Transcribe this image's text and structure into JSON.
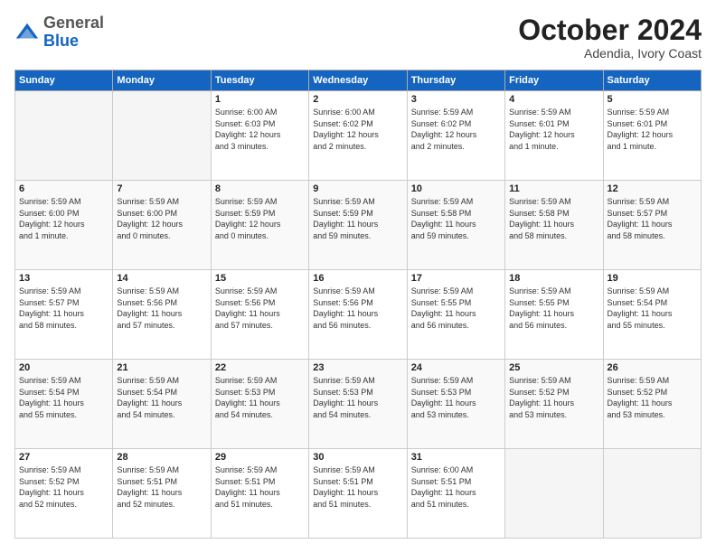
{
  "header": {
    "logo": {
      "line1": "General",
      "line2": "Blue"
    },
    "month": "October 2024",
    "location": "Adendia, Ivory Coast"
  },
  "weekdays": [
    "Sunday",
    "Monday",
    "Tuesday",
    "Wednesday",
    "Thursday",
    "Friday",
    "Saturday"
  ],
  "weeks": [
    [
      {
        "day": "",
        "info": ""
      },
      {
        "day": "",
        "info": ""
      },
      {
        "day": "1",
        "info": "Sunrise: 6:00 AM\nSunset: 6:03 PM\nDaylight: 12 hours\nand 3 minutes."
      },
      {
        "day": "2",
        "info": "Sunrise: 6:00 AM\nSunset: 6:02 PM\nDaylight: 12 hours\nand 2 minutes."
      },
      {
        "day": "3",
        "info": "Sunrise: 5:59 AM\nSunset: 6:02 PM\nDaylight: 12 hours\nand 2 minutes."
      },
      {
        "day": "4",
        "info": "Sunrise: 5:59 AM\nSunset: 6:01 PM\nDaylight: 12 hours\nand 1 minute."
      },
      {
        "day": "5",
        "info": "Sunrise: 5:59 AM\nSunset: 6:01 PM\nDaylight: 12 hours\nand 1 minute."
      }
    ],
    [
      {
        "day": "6",
        "info": "Sunrise: 5:59 AM\nSunset: 6:00 PM\nDaylight: 12 hours\nand 1 minute."
      },
      {
        "day": "7",
        "info": "Sunrise: 5:59 AM\nSunset: 6:00 PM\nDaylight: 12 hours\nand 0 minutes."
      },
      {
        "day": "8",
        "info": "Sunrise: 5:59 AM\nSunset: 5:59 PM\nDaylight: 12 hours\nand 0 minutes."
      },
      {
        "day": "9",
        "info": "Sunrise: 5:59 AM\nSunset: 5:59 PM\nDaylight: 11 hours\nand 59 minutes."
      },
      {
        "day": "10",
        "info": "Sunrise: 5:59 AM\nSunset: 5:58 PM\nDaylight: 11 hours\nand 59 minutes."
      },
      {
        "day": "11",
        "info": "Sunrise: 5:59 AM\nSunset: 5:58 PM\nDaylight: 11 hours\nand 58 minutes."
      },
      {
        "day": "12",
        "info": "Sunrise: 5:59 AM\nSunset: 5:57 PM\nDaylight: 11 hours\nand 58 minutes."
      }
    ],
    [
      {
        "day": "13",
        "info": "Sunrise: 5:59 AM\nSunset: 5:57 PM\nDaylight: 11 hours\nand 58 minutes."
      },
      {
        "day": "14",
        "info": "Sunrise: 5:59 AM\nSunset: 5:56 PM\nDaylight: 11 hours\nand 57 minutes."
      },
      {
        "day": "15",
        "info": "Sunrise: 5:59 AM\nSunset: 5:56 PM\nDaylight: 11 hours\nand 57 minutes."
      },
      {
        "day": "16",
        "info": "Sunrise: 5:59 AM\nSunset: 5:56 PM\nDaylight: 11 hours\nand 56 minutes."
      },
      {
        "day": "17",
        "info": "Sunrise: 5:59 AM\nSunset: 5:55 PM\nDaylight: 11 hours\nand 56 minutes."
      },
      {
        "day": "18",
        "info": "Sunrise: 5:59 AM\nSunset: 5:55 PM\nDaylight: 11 hours\nand 56 minutes."
      },
      {
        "day": "19",
        "info": "Sunrise: 5:59 AM\nSunset: 5:54 PM\nDaylight: 11 hours\nand 55 minutes."
      }
    ],
    [
      {
        "day": "20",
        "info": "Sunrise: 5:59 AM\nSunset: 5:54 PM\nDaylight: 11 hours\nand 55 minutes."
      },
      {
        "day": "21",
        "info": "Sunrise: 5:59 AM\nSunset: 5:54 PM\nDaylight: 11 hours\nand 54 minutes."
      },
      {
        "day": "22",
        "info": "Sunrise: 5:59 AM\nSunset: 5:53 PM\nDaylight: 11 hours\nand 54 minutes."
      },
      {
        "day": "23",
        "info": "Sunrise: 5:59 AM\nSunset: 5:53 PM\nDaylight: 11 hours\nand 54 minutes."
      },
      {
        "day": "24",
        "info": "Sunrise: 5:59 AM\nSunset: 5:53 PM\nDaylight: 11 hours\nand 53 minutes."
      },
      {
        "day": "25",
        "info": "Sunrise: 5:59 AM\nSunset: 5:52 PM\nDaylight: 11 hours\nand 53 minutes."
      },
      {
        "day": "26",
        "info": "Sunrise: 5:59 AM\nSunset: 5:52 PM\nDaylight: 11 hours\nand 53 minutes."
      }
    ],
    [
      {
        "day": "27",
        "info": "Sunrise: 5:59 AM\nSunset: 5:52 PM\nDaylight: 11 hours\nand 52 minutes."
      },
      {
        "day": "28",
        "info": "Sunrise: 5:59 AM\nSunset: 5:51 PM\nDaylight: 11 hours\nand 52 minutes."
      },
      {
        "day": "29",
        "info": "Sunrise: 5:59 AM\nSunset: 5:51 PM\nDaylight: 11 hours\nand 51 minutes."
      },
      {
        "day": "30",
        "info": "Sunrise: 5:59 AM\nSunset: 5:51 PM\nDaylight: 11 hours\nand 51 minutes."
      },
      {
        "day": "31",
        "info": "Sunrise: 6:00 AM\nSunset: 5:51 PM\nDaylight: 11 hours\nand 51 minutes."
      },
      {
        "day": "",
        "info": ""
      },
      {
        "day": "",
        "info": ""
      }
    ]
  ]
}
